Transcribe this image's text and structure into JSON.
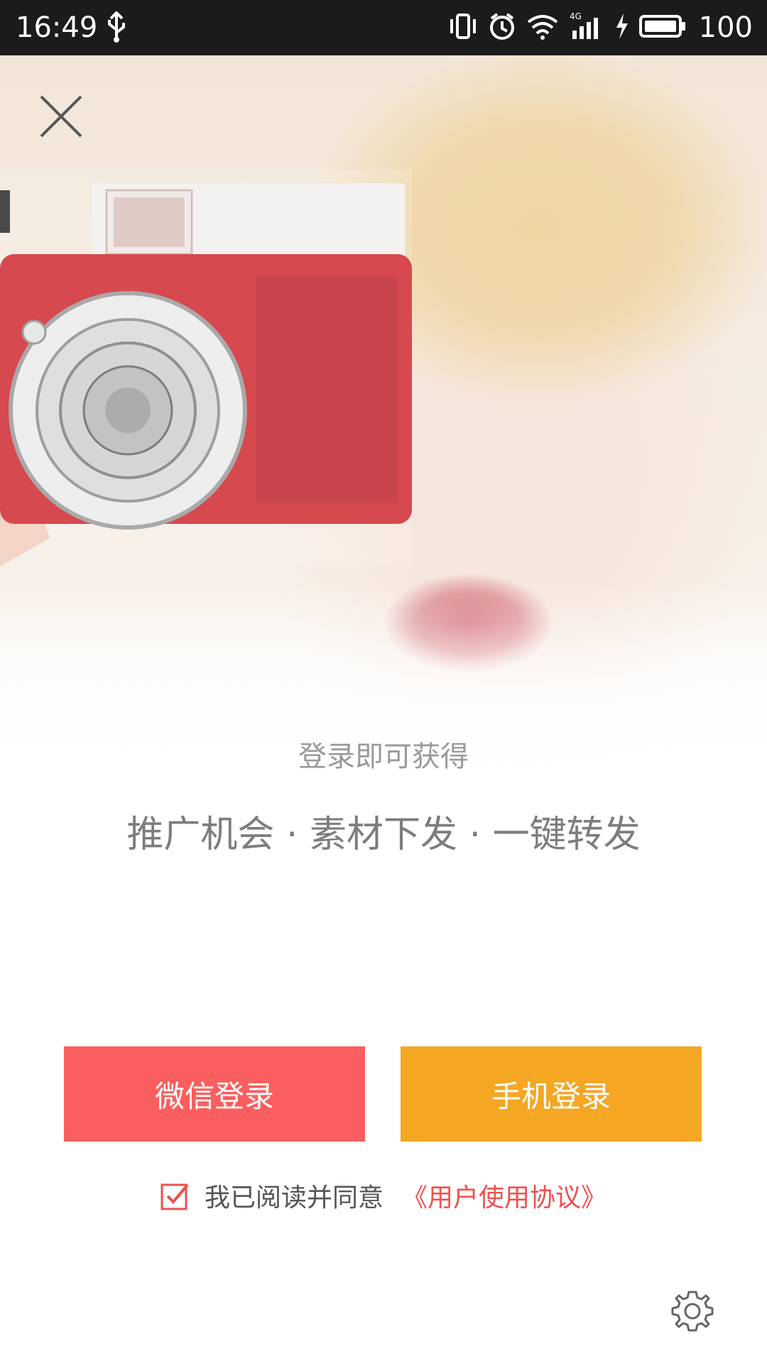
{
  "status_bar": {
    "time": "16:49",
    "battery_percent": "100",
    "network_label": "4G",
    "icons": [
      "usb-icon",
      "vibrate-icon",
      "alarm-icon",
      "wifi-icon",
      "signal-icon",
      "charging-icon",
      "battery-icon"
    ]
  },
  "hero": {
    "close_icon": "close-icon"
  },
  "promo": {
    "subtitle": "登录即可获得",
    "title": "推广机会 · 素材下发 · 一键转发"
  },
  "buttons": {
    "wechat_login": "微信登录",
    "phone_login": "手机登录"
  },
  "agreement": {
    "checked": true,
    "text": "我已阅读并同意",
    "link": "《用户使用协议》"
  },
  "settings": {
    "icon": "gear-icon"
  },
  "colors": {
    "wechat_button": "#fb5e5e",
    "phone_button": "#f5a623",
    "link": "#f0504f",
    "status_bar": "#1b1b1b"
  }
}
